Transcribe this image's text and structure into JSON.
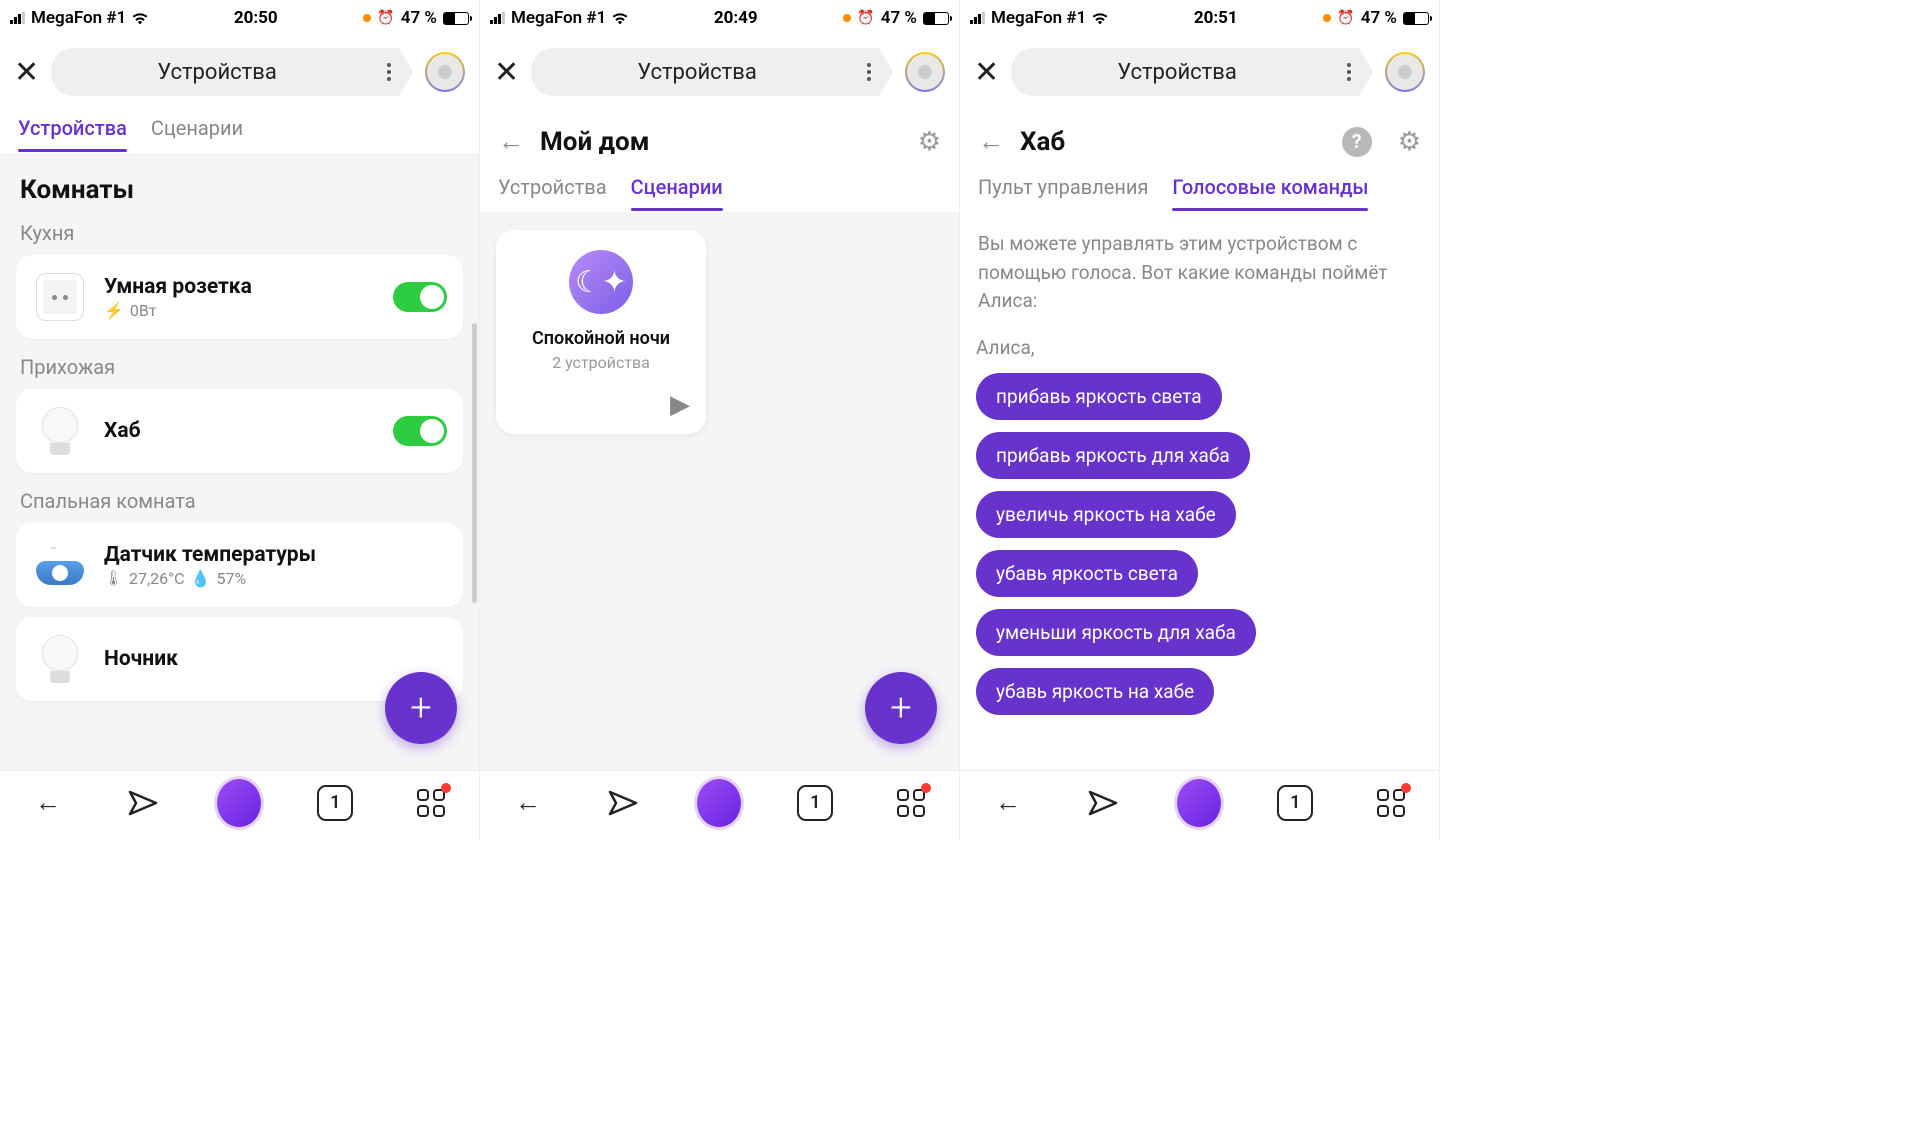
{
  "status": {
    "carrier": "MegaFon #1",
    "battery_pct": "47 %",
    "times": [
      "20:50",
      "20:49",
      "20:51"
    ]
  },
  "appbar": {
    "title": "Устройства"
  },
  "screen1": {
    "tabs": [
      "Устройства",
      "Сценарии"
    ],
    "rooms_title": "Комнаты",
    "rooms": {
      "kitchen": {
        "label": "Кухня",
        "device": "Умная розетка",
        "power": "0Вт"
      },
      "hallway": {
        "label": "Прихожая",
        "device": "Хаб"
      },
      "bedroom": {
        "label": "Спальная комната",
        "sensor_name": "Датчик температуры",
        "temp": "27,26°C",
        "humidity": "57%",
        "nightlight": "Ночник"
      }
    }
  },
  "screen2": {
    "title": "Мой дом",
    "tabs": [
      "Устройства",
      "Сценарии"
    ],
    "scenario": {
      "name": "Спокойной ночи",
      "sub": "2 устройства"
    }
  },
  "screen3": {
    "title": "Хаб",
    "tabs": [
      "Пульт управления",
      "Голосовые команды"
    ],
    "intro": "Вы можете управлять этим устройством с помощью голоса. Вот какие команды поймёт Алиса:",
    "call": "Алиса,",
    "commands": [
      "прибавь яркость света",
      "прибавь яркость для хаба",
      "увеличь яркость на хабе",
      "убавь яркость света",
      "уменьши яркость для хаба",
      "убавь яркость на хабе"
    ]
  },
  "nav": {
    "tab_count": "1"
  }
}
